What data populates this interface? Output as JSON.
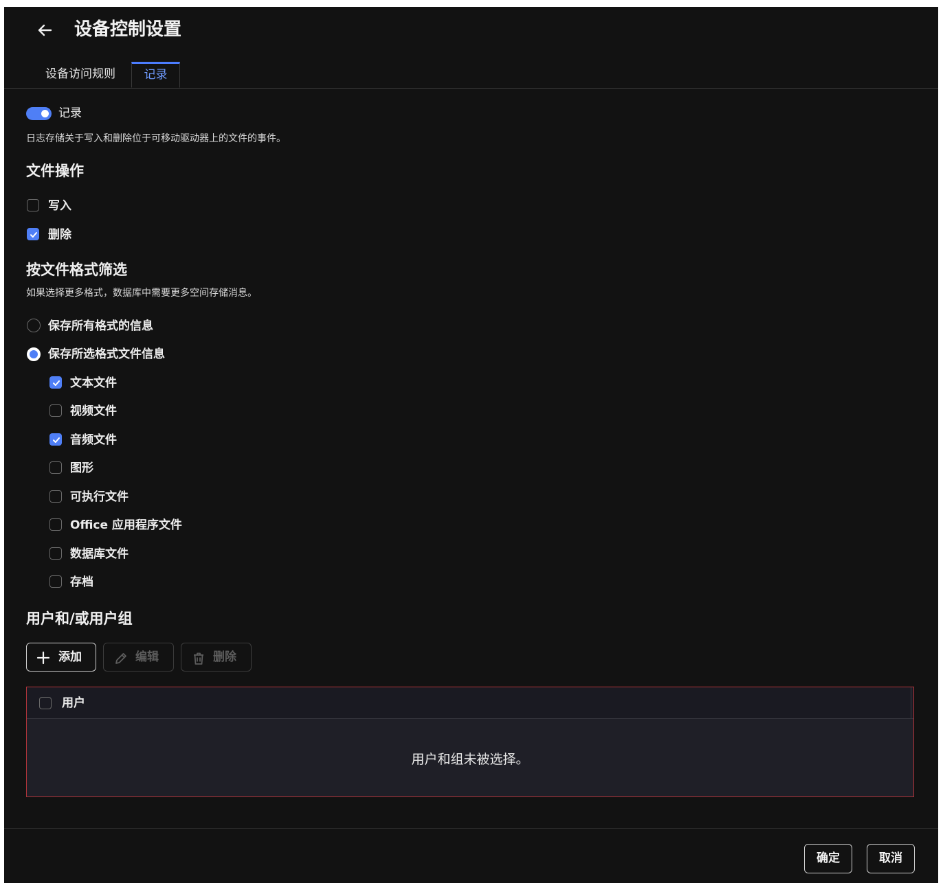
{
  "header": {
    "back_icon": "arrow-left-icon",
    "title": "设备控制设置"
  },
  "tabs": [
    {
      "label": "设备访问规则",
      "active": false
    },
    {
      "label": "记录",
      "active": true
    }
  ],
  "logging": {
    "toggle_on": true,
    "toggle_label": "记录",
    "description": "日志存储关于写入和删除位于可移动驱动器上的文件的事件。"
  },
  "file_operations": {
    "heading": "文件操作",
    "items": [
      {
        "label": "写入",
        "checked": false
      },
      {
        "label": "删除",
        "checked": true
      }
    ]
  },
  "format_filter": {
    "heading": "按文件格式筛选",
    "description": "如果选择更多格式，数据库中需要更多空间存储消息。",
    "options": [
      {
        "label": "保存所有格式的信息",
        "selected": false
      },
      {
        "label": "保存所选格式文件信息",
        "selected": true
      }
    ],
    "formats": [
      {
        "label": "文本文件",
        "checked": true
      },
      {
        "label": "视频文件",
        "checked": false
      },
      {
        "label": "音频文件",
        "checked": true
      },
      {
        "label": "图形",
        "checked": false
      },
      {
        "label": "可执行文件",
        "checked": false
      },
      {
        "label": "Office 应用程序文件",
        "checked": false
      },
      {
        "label": "数据库文件",
        "checked": false
      },
      {
        "label": "存档",
        "checked": false
      }
    ]
  },
  "users": {
    "heading": "用户和/或用户组",
    "toolbar": {
      "add_label": "添加",
      "edit_label": "编辑",
      "delete_label": "删除"
    },
    "table": {
      "column_header": "用户",
      "empty_text": "用户和组未被选择。"
    }
  },
  "footer": {
    "ok_label": "确定",
    "cancel_label": "取消"
  },
  "colors": {
    "accent": "#4f7ff6",
    "background": "#121212",
    "error_border": "#b0343a"
  }
}
